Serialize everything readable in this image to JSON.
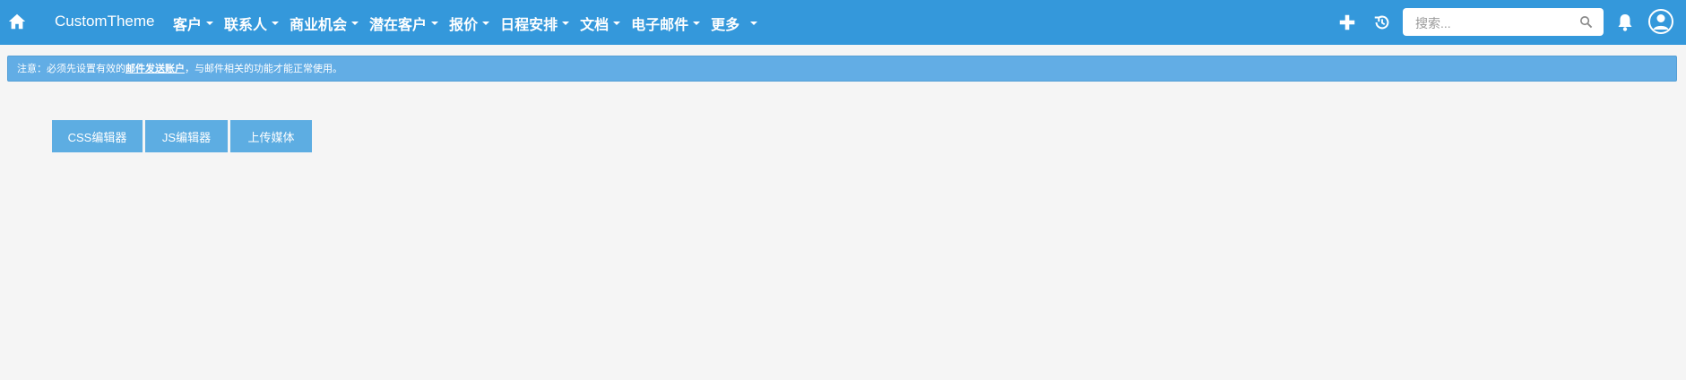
{
  "app": {
    "brand": "CustomTheme"
  },
  "nav": {
    "items": [
      {
        "label": "客户"
      },
      {
        "label": "联系人"
      },
      {
        "label": "商业机会"
      },
      {
        "label": "潜在客户"
      },
      {
        "label": "报价"
      },
      {
        "label": "日程安排"
      },
      {
        "label": "文档"
      },
      {
        "label": "电子邮件"
      },
      {
        "label": "更多"
      }
    ]
  },
  "header": {
    "search_placeholder": "搜索...",
    "icons": [
      "home-icon",
      "plus-icon",
      "history-icon",
      "search-icon",
      "bell-icon",
      "user-avatar-icon"
    ]
  },
  "notice": {
    "prefix": "注意：必须先设置有效的",
    "link": "邮件发送账户",
    "suffix": "，与邮件相关的功能才能正常使用。"
  },
  "toolbar": {
    "css_editor": "CSS编辑器",
    "js_editor": "JS编辑器",
    "upload_media": "上传媒体"
  },
  "colors": {
    "topbar": "#3498db",
    "notice": "#62ade5",
    "button": "#5dade2",
    "page_bg": "#f5f5f5"
  }
}
